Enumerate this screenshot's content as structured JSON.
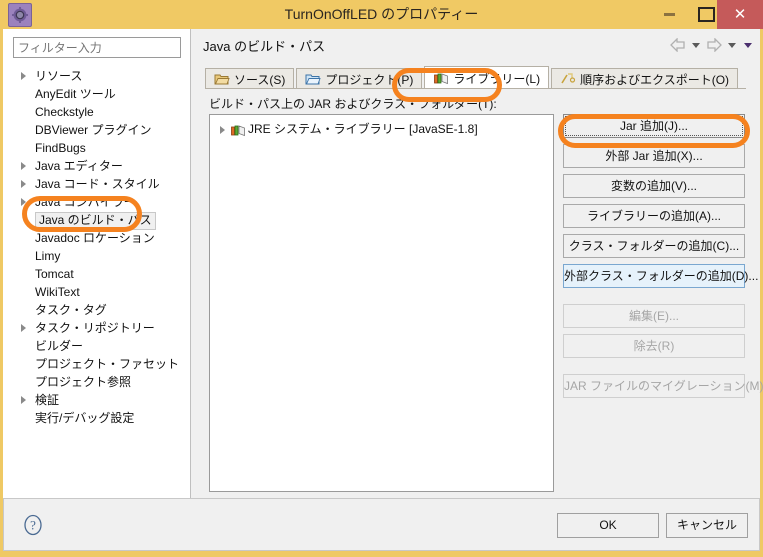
{
  "window": {
    "title": "TurnOnOffLED のプロパティー",
    "icon": "properties-gear-icon",
    "controls": {
      "minimize": "minimize",
      "maximize": "maximize",
      "close": "close"
    },
    "titlebar_color": "#f0c964",
    "close_color": "#c55a5a",
    "annotation_color": "#f5821f"
  },
  "sidebar": {
    "filter": {
      "value": "フィルター入力",
      "placeholder": "フィルター入力"
    },
    "items": [
      {
        "label": "リソース",
        "expandable": true,
        "selected": false
      },
      {
        "label": "AnyEdit ツール",
        "expandable": false,
        "selected": false
      },
      {
        "label": "Checkstyle",
        "expandable": false,
        "selected": false
      },
      {
        "label": "DBViewer プラグイン",
        "expandable": false,
        "selected": false
      },
      {
        "label": "FindBugs",
        "expandable": false,
        "selected": false
      },
      {
        "label": "Java エディター",
        "expandable": true,
        "selected": false
      },
      {
        "label": "Java コード・スタイル",
        "expandable": true,
        "selected": false
      },
      {
        "label": "Java コンパイラー",
        "expandable": true,
        "selected": false
      },
      {
        "label": "Java のビルド・パス",
        "expandable": false,
        "selected": true
      },
      {
        "label": "Javadoc ロケーション",
        "expandable": false,
        "selected": false
      },
      {
        "label": "Limy",
        "expandable": false,
        "selected": false
      },
      {
        "label": "Tomcat",
        "expandable": false,
        "selected": false
      },
      {
        "label": "WikiText",
        "expandable": false,
        "selected": false
      },
      {
        "label": "タスク・タグ",
        "expandable": false,
        "selected": false
      },
      {
        "label": "タスク・リポジトリー",
        "expandable": true,
        "selected": false
      },
      {
        "label": "ビルダー",
        "expandable": false,
        "selected": false
      },
      {
        "label": "プロジェクト・ファセット",
        "expandable": false,
        "selected": false
      },
      {
        "label": "プロジェクト参照",
        "expandable": false,
        "selected": false
      },
      {
        "label": "検証",
        "expandable": true,
        "selected": false
      },
      {
        "label": "実行/デバッグ設定",
        "expandable": false,
        "selected": false
      }
    ]
  },
  "main": {
    "page_title": "Java のビルド・パス",
    "nav": {
      "back": "back-arrow",
      "back_menu": "back-dropdown",
      "forward": "forward-arrow",
      "forward_menu": "forward-dropdown",
      "view_menu": "view-menu"
    },
    "tabs": [
      {
        "label": "ソース(S)",
        "icon": "source-folder-icon",
        "active": false
      },
      {
        "label": "プロジェクト(P)",
        "icon": "project-folder-icon",
        "active": false
      },
      {
        "label": "ライブラリー(L)",
        "icon": "library-books-icon",
        "active": true
      },
      {
        "label": "順序およびエクスポート(O)",
        "icon": "order-export-icon",
        "active": false
      }
    ],
    "caption": "ビルド・パス上の JAR およびクラス・フォルダー(T):",
    "caption_mnemonic": "T",
    "entries": [
      {
        "label": "JRE システム・ライブラリー [JavaSE-1.8]",
        "icon": "library-books-icon",
        "expandable": true
      }
    ],
    "buttons": [
      {
        "label": "Jar 追加(J)...",
        "mnemonic": "J",
        "state": "focused"
      },
      {
        "label": "外部 Jar 追加(X)...",
        "mnemonic": "X",
        "state": "normal"
      },
      {
        "label": "変数の追加(V)...",
        "mnemonic": "V",
        "state": "normal"
      },
      {
        "label": "ライブラリーの追加(A)...",
        "mnemonic": "A",
        "state": "normal"
      },
      {
        "label": "クラス・フォルダーの追加(C)...",
        "mnemonic": "C",
        "state": "normal"
      },
      {
        "label": "外部クラス・フォルダーの追加(D)...",
        "mnemonic": "D",
        "state": "hover"
      },
      {
        "label": "編集(E)...",
        "mnemonic": "E",
        "state": "disabled",
        "gap_above": true
      },
      {
        "label": "除去(R)",
        "mnemonic": "R",
        "state": "disabled"
      },
      {
        "label": "JAR ファイルのマイグレーション(M)...",
        "mnemonic": "M",
        "state": "disabled",
        "gap_above": true
      }
    ]
  },
  "footer": {
    "help": "help-icon",
    "ok": "OK",
    "cancel": "キャンセル"
  },
  "annotations": [
    {
      "name": "sidebar-java-build-path-highlight",
      "target": "Java のビルド・パス"
    },
    {
      "name": "library-tab-highlight",
      "target": "ライブラリー(L)"
    },
    {
      "name": "add-jar-button-highlight",
      "target": "Jar 追加(J)..."
    }
  ]
}
